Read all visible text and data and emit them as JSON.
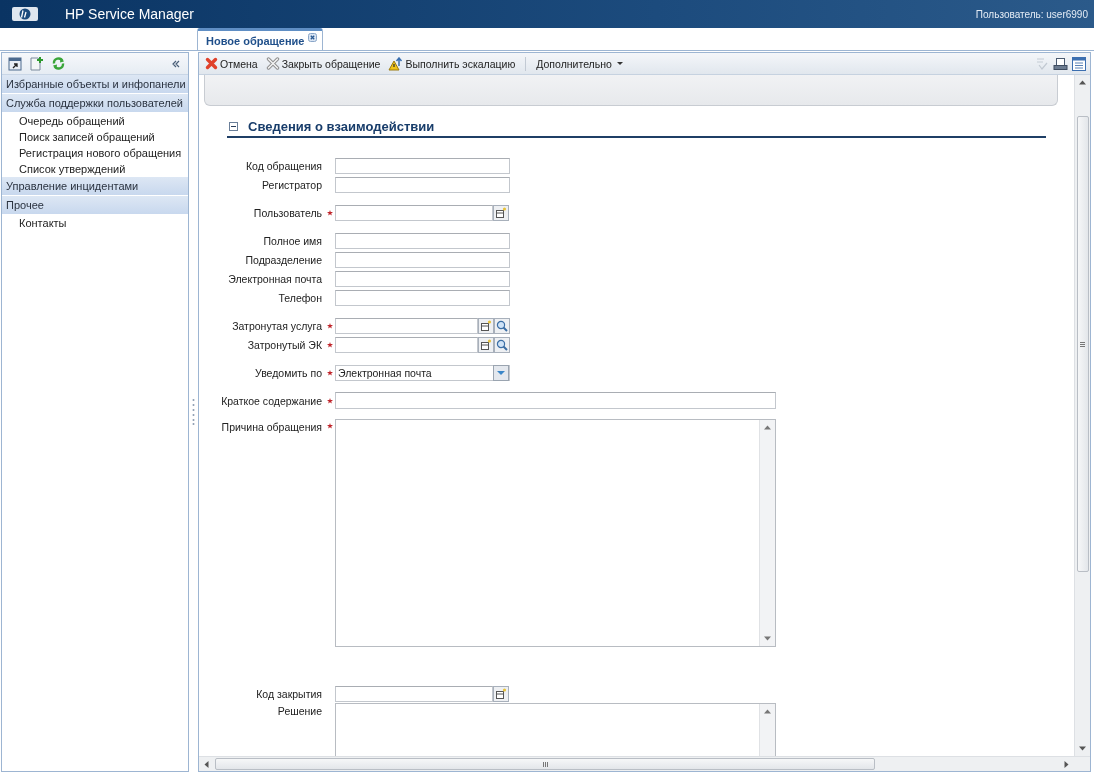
{
  "header": {
    "title": "HP Service Manager",
    "user": "Пользователь: user6990"
  },
  "tabs": [
    {
      "label": "Новое обращение",
      "selected": true
    }
  ],
  "sidebar": {
    "sections": [
      {
        "label": "Избранные объекты и инфопанели"
      },
      {
        "label": "Служба поддержки пользователей",
        "children": [
          {
            "label": "Очередь обращений"
          },
          {
            "label": "Поиск записей обращений"
          },
          {
            "label": "Регистрация нового обращения"
          },
          {
            "label": "Список утверждений"
          }
        ]
      },
      {
        "label": "Управление инцидентами"
      },
      {
        "label": "Прочее",
        "children": [
          {
            "label": "Контакты"
          }
        ]
      }
    ]
  },
  "toolbar": {
    "buttons": [
      {
        "kind": "cancel",
        "label": "Отмена"
      },
      {
        "kind": "close",
        "label": "Закрыть обращение"
      },
      {
        "kind": "escalate",
        "label": "Выполнить эскалацию"
      },
      {
        "kind": "menu",
        "label": "Дополнительно"
      }
    ]
  },
  "section": {
    "title": "Сведения о взаимодействии",
    "expanded": true
  },
  "field_groups": [
    {
      "fields": [
        {
          "label": "Код обращения",
          "kind": "text",
          "required": false
        },
        {
          "label": "Регистратор",
          "kind": "text",
          "required": false
        }
      ]
    },
    {
      "fields": [
        {
          "label": "Пользователь",
          "kind": "lookup",
          "required": true
        }
      ]
    },
    {
      "fields": [
        {
          "label": "Полное имя",
          "kind": "text",
          "required": false
        },
        {
          "label": "Подразделение",
          "kind": "text",
          "required": false
        },
        {
          "label": "Электронная почта",
          "kind": "text",
          "required": false
        },
        {
          "label": "Телефон",
          "kind": "text",
          "required": false
        }
      ]
    },
    {
      "fields": [
        {
          "label": "Затронутая услуга",
          "kind": "lookup-search",
          "required": true
        },
        {
          "label": "Затронутый ЭК",
          "kind": "lookup-search",
          "required": true
        }
      ]
    },
    {
      "fields": [
        {
          "label": "Уведомить по",
          "kind": "select",
          "required": true,
          "value": "Электронная почта"
        }
      ]
    },
    {
      "fields": [
        {
          "label": "Краткое содержание",
          "kind": "wide",
          "required": true
        }
      ]
    },
    {
      "fields": [
        {
          "label": "Причина обращения",
          "kind": "textarea",
          "required": true
        }
      ]
    },
    {
      "fields": [
        {
          "label": "Код закрытия",
          "kind": "lookup",
          "required": false
        },
        {
          "label": "Решение",
          "kind": "textarea",
          "required": false
        }
      ]
    }
  ]
}
